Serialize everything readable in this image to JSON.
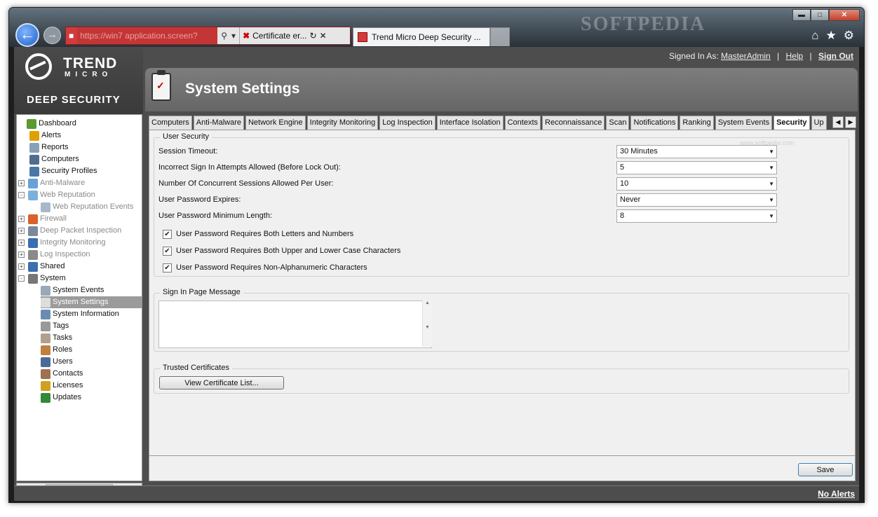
{
  "browser": {
    "watermark": "SOFTPEDIA",
    "address_url": "https://win7",
    "address_url_tail": "application.screen?",
    "cert_error_label": "Certificate er...",
    "active_tab_title": "Trend Micro Deep Security ..."
  },
  "app": {
    "logo_trend": "TREND",
    "logo_micro": "MICRO",
    "logo_product": "DEEP SECURITY",
    "signed_in_prefix": "Signed In As:",
    "signed_in_user": "MasterAdmin",
    "help": "Help",
    "sign_out": "Sign Out",
    "page_title": "System Settings",
    "no_alerts": "No Alerts"
  },
  "sidebar": {
    "items": [
      {
        "label": "Dashboard",
        "icon": "dashboard-icon",
        "color": "#5a9a2e"
      },
      {
        "label": "Alerts",
        "icon": "alert-icon",
        "color": "#e0a000"
      },
      {
        "label": "Reports",
        "icon": "report-icon",
        "color": "#8aa0b8"
      },
      {
        "label": "Computers",
        "icon": "computer-icon",
        "color": "#4f6d8f"
      },
      {
        "label": "Security Profiles",
        "icon": "profile-icon",
        "color": "#4b77a8"
      },
      {
        "label": "Anti-Malware",
        "icon": "antimalware-icon",
        "color": "#6aa0d8"
      },
      {
        "label": "Web Reputation",
        "icon": "web-reputation-icon",
        "color": "#7ab0e0"
      },
      {
        "label": "Web Reputation Events",
        "icon": "events-icon",
        "color": "#a8b8c8"
      },
      {
        "label": "Firewall",
        "icon": "firewall-icon",
        "color": "#d8622a"
      },
      {
        "label": "Deep Packet Inspection",
        "icon": "dpi-icon",
        "color": "#7a8a99"
      },
      {
        "label": "Integrity Monitoring",
        "icon": "integrity-icon",
        "color": "#3b6db3"
      },
      {
        "label": "Log Inspection",
        "icon": "log-icon",
        "color": "#8a8a8a"
      },
      {
        "label": "Shared",
        "icon": "shared-icon",
        "color": "#3a6fb0"
      },
      {
        "label": "System",
        "icon": "gear-icon",
        "color": "#777777"
      },
      {
        "label": "System Events",
        "icon": "events-icon",
        "color": "#9aa8b8"
      },
      {
        "label": "System Settings",
        "icon": "clipboard-icon",
        "color": "#dddddd"
      },
      {
        "label": "System Information",
        "icon": "info-icon",
        "color": "#6a8cb0"
      },
      {
        "label": "Tags",
        "icon": "tag-icon",
        "color": "#999999"
      },
      {
        "label": "Tasks",
        "icon": "task-icon",
        "color": "#b0a090"
      },
      {
        "label": "Roles",
        "icon": "roles-icon",
        "color": "#c08040"
      },
      {
        "label": "Users",
        "icon": "user-icon",
        "color": "#4a6a9a"
      },
      {
        "label": "Contacts",
        "icon": "contacts-icon",
        "color": "#a07050"
      },
      {
        "label": "Licenses",
        "icon": "key-icon",
        "color": "#d0a020"
      },
      {
        "label": "Updates",
        "icon": "update-icon",
        "color": "#2f8a3a"
      }
    ]
  },
  "tabs": [
    "Computers",
    "Anti-Malware",
    "Network Engine",
    "Integrity Monitoring",
    "Log Inspection",
    "Interface Isolation",
    "Contexts",
    "Reconnaissance",
    "Scan",
    "Notifications",
    "Ranking",
    "System Events",
    "Security",
    "Up"
  ],
  "active_tab": "Security",
  "security": {
    "legend": "User Security",
    "watermark": "www.softpedia.com",
    "fields": [
      {
        "label": "Session Timeout:",
        "value": "30 Minutes"
      },
      {
        "label": "Incorrect Sign In Attempts Allowed (Before Lock Out):",
        "value": "5"
      },
      {
        "label": "Number Of Concurrent Sessions Allowed Per User:",
        "value": "10"
      },
      {
        "label": "User Password Expires:",
        "value": "Never"
      },
      {
        "label": "User Password Minimum Length:",
        "value": "8"
      }
    ],
    "checkboxes": [
      {
        "label": "User Password Requires Both Letters and Numbers",
        "checked": true
      },
      {
        "label": "User Password Requires Both Upper and Lower Case Characters",
        "checked": true
      },
      {
        "label": "User Password Requires Non-Alphanumeric Characters",
        "checked": true
      }
    ]
  },
  "signin": {
    "legend": "Sign In Page Message",
    "value": ""
  },
  "certs": {
    "legend": "Trusted Certificates",
    "button": "View Certificate List..."
  },
  "save": "Save"
}
